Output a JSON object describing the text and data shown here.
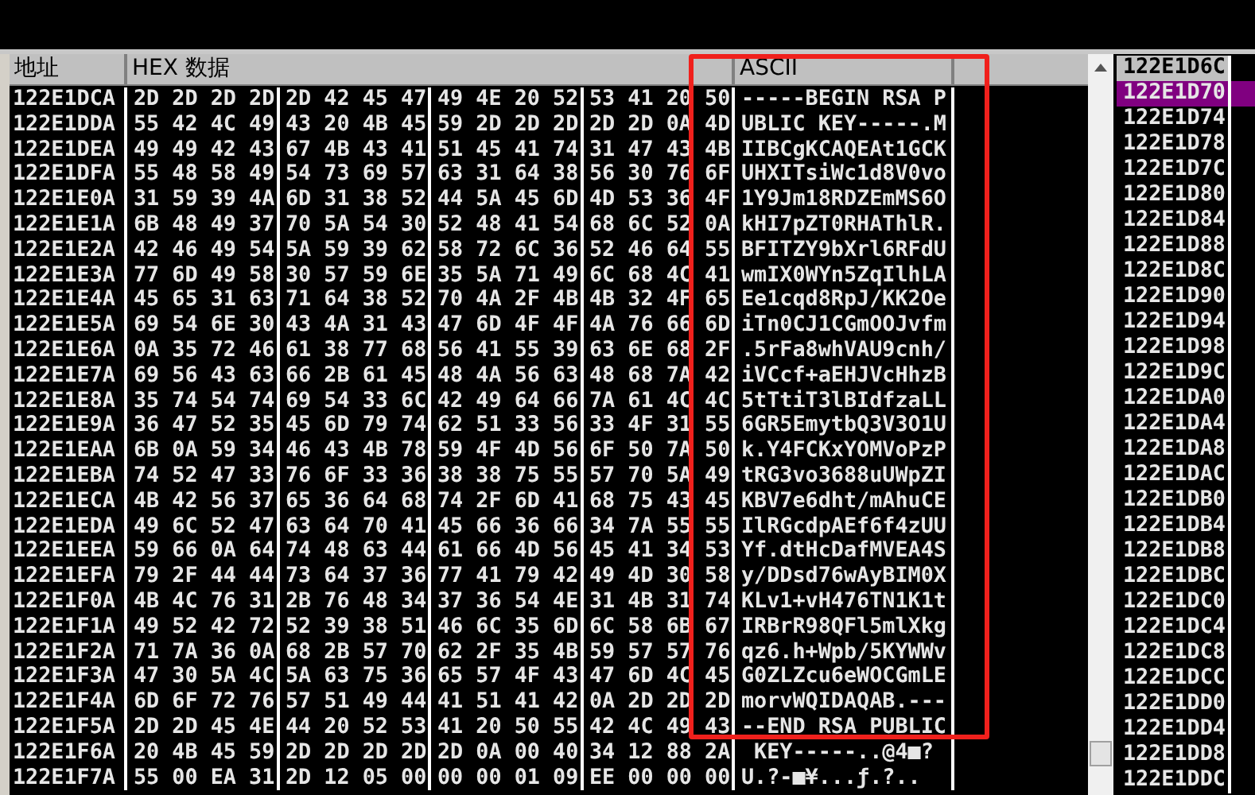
{
  "header": {
    "columns": [
      "地址",
      "HEX 数据",
      "ASCII"
    ]
  },
  "rows": [
    {
      "address": "122E1DCA",
      "hex": [
        "2D 2D 2D 2D",
        "2D 42 45 47",
        "49 4E 20 52",
        "53 41 20 50"
      ],
      "ascii": "-----BEGIN RSA P"
    },
    {
      "address": "122E1DDA",
      "hex": [
        "55 42 4C 49",
        "43 20 4B 45",
        "59 2D 2D 2D",
        "2D 2D 0A 4D"
      ],
      "ascii": "UBLIC KEY-----.M"
    },
    {
      "address": "122E1DEA",
      "hex": [
        "49 49 42 43",
        "67 4B 43 41",
        "51 45 41 74",
        "31 47 43 4B"
      ],
      "ascii": "IIBCgKCAQEAt1GCK"
    },
    {
      "address": "122E1DFA",
      "hex": [
        "55 48 58 49",
        "54 73 69 57",
        "63 31 64 38",
        "56 30 76 6F"
      ],
      "ascii": "UHXITsiWc1d8V0vo"
    },
    {
      "address": "122E1E0A",
      "hex": [
        "31 59 39 4A",
        "6D 31 38 52",
        "44 5A 45 6D",
        "4D 53 36 4F"
      ],
      "ascii": "1Y9Jm18RDZEmMS6O"
    },
    {
      "address": "122E1E1A",
      "hex": [
        "6B 48 49 37",
        "70 5A 54 30",
        "52 48 41 54",
        "68 6C 52 0A"
      ],
      "ascii": "kHI7pZT0RHAThlR."
    },
    {
      "address": "122E1E2A",
      "hex": [
        "42 46 49 54",
        "5A 59 39 62",
        "58 72 6C 36",
        "52 46 64 55"
      ],
      "ascii": "BFITZY9bXrl6RFdU"
    },
    {
      "address": "122E1E3A",
      "hex": [
        "77 6D 49 58",
        "30 57 59 6E",
        "35 5A 71 49",
        "6C 68 4C 41"
      ],
      "ascii": "wmIX0WYn5ZqIlhLA"
    },
    {
      "address": "122E1E4A",
      "hex": [
        "45 65 31 63",
        "71 64 38 52",
        "70 4A 2F 4B",
        "4B 32 4F 65"
      ],
      "ascii": "Ee1cqd8RpJ/KK2Oe"
    },
    {
      "address": "122E1E5A",
      "hex": [
        "69 54 6E 30",
        "43 4A 31 43",
        "47 6D 4F 4F",
        "4A 76 66 6D"
      ],
      "ascii": "iTn0CJ1CGmOOJvfm"
    },
    {
      "address": "122E1E6A",
      "hex": [
        "0A 35 72 46",
        "61 38 77 68",
        "56 41 55 39",
        "63 6E 68 2F"
      ],
      "ascii": ".5rFa8whVAU9cnh/"
    },
    {
      "address": "122E1E7A",
      "hex": [
        "69 56 43 63",
        "66 2B 61 45",
        "48 4A 56 63",
        "48 68 7A 42"
      ],
      "ascii": "iVCcf+aEHJVcHhzB"
    },
    {
      "address": "122E1E8A",
      "hex": [
        "35 74 54 74",
        "69 54 33 6C",
        "42 49 64 66",
        "7A 61 4C 4C"
      ],
      "ascii": "5tTtiT3lBIdfzaLL"
    },
    {
      "address": "122E1E9A",
      "hex": [
        "36 47 52 35",
        "45 6D 79 74",
        "62 51 33 56",
        "33 4F 31 55"
      ],
      "ascii": "6GR5EmytbQ3V3O1U"
    },
    {
      "address": "122E1EAA",
      "hex": [
        "6B 0A 59 34",
        "46 43 4B 78",
        "59 4F 4D 56",
        "6F 50 7A 50"
      ],
      "ascii": "k.Y4FCKxYOMVoPzP"
    },
    {
      "address": "122E1EBA",
      "hex": [
        "74 52 47 33",
        "76 6F 33 36",
        "38 38 75 55",
        "57 70 5A 49"
      ],
      "ascii": "tRG3vo3688uUWpZI"
    },
    {
      "address": "122E1ECA",
      "hex": [
        "4B 42 56 37",
        "65 36 64 68",
        "74 2F 6D 41",
        "68 75 43 45"
      ],
      "ascii": "KBV7e6dht/mAhuCE"
    },
    {
      "address": "122E1EDA",
      "hex": [
        "49 6C 52 47",
        "63 64 70 41",
        "45 66 36 66",
        "34 7A 55 55"
      ],
      "ascii": "IlRGcdpAEf6f4zUU"
    },
    {
      "address": "122E1EEA",
      "hex": [
        "59 66 0A 64",
        "74 48 63 44",
        "61 66 4D 56",
        "45 41 34 53"
      ],
      "ascii": "Yf.dtHcDafMVEA4S"
    },
    {
      "address": "122E1EFA",
      "hex": [
        "79 2F 44 44",
        "73 64 37 36",
        "77 41 79 42",
        "49 4D 30 58"
      ],
      "ascii": "y/DDsd76wAyBIM0X"
    },
    {
      "address": "122E1F0A",
      "hex": [
        "4B 4C 76 31",
        "2B 76 48 34",
        "37 36 54 4E",
        "31 4B 31 74"
      ],
      "ascii": "KLv1+vH476TN1K1t"
    },
    {
      "address": "122E1F1A",
      "hex": [
        "49 52 42 72",
        "52 39 38 51",
        "46 6C 35 6D",
        "6C 58 6B 67"
      ],
      "ascii": "IRBrR98QFl5mlXkg"
    },
    {
      "address": "122E1F2A",
      "hex": [
        "71 7A 36 0A",
        "68 2B 57 70",
        "62 2F 35 4B",
        "59 57 57 76"
      ],
      "ascii": "qz6.h+Wpb/5KYWWv"
    },
    {
      "address": "122E1F3A",
      "hex": [
        "47 30 5A 4C",
        "5A 63 75 36",
        "65 57 4F 43",
        "47 6D 4C 45"
      ],
      "ascii": "G0ZLZcu6eWOCGmLE"
    },
    {
      "address": "122E1F4A",
      "hex": [
        "6D 6F 72 76",
        "57 51 49 44",
        "41 51 41 42",
        "0A 2D 2D 2D"
      ],
      "ascii": "morvWQIDAQAB.---"
    },
    {
      "address": "122E1F5A",
      "hex": [
        "2D 2D 45 4E",
        "44 20 52 53",
        "41 20 50 55",
        "42 4C 49 43"
      ],
      "ascii": "--END RSA PUBLIC"
    },
    {
      "address": "122E1F6A",
      "hex": [
        "20 4B 45 59",
        "2D 2D 2D 2D",
        "2D 0A 00 40",
        "34 12 88 2A"
      ],
      "ascii": " KEY-----..@4■?"
    },
    {
      "address": "122E1F7A",
      "hex": [
        "55 00 EA 31",
        "2D 12 05 00",
        "00 00 01 09",
        "EE 00 00 00"
      ],
      "ascii": "U.?-■¥...ƒ.?.."
    }
  ],
  "stack": {
    "rows": [
      {
        "address": "122E1D6C",
        "marked": true,
        "selected": false
      },
      {
        "address": "122E1D70",
        "marked": false,
        "selected": true
      },
      {
        "address": "122E1D74",
        "marked": false,
        "selected": false
      },
      {
        "address": "122E1D78",
        "marked": false,
        "selected": false
      },
      {
        "address": "122E1D7C",
        "marked": false,
        "selected": false
      },
      {
        "address": "122E1D80",
        "marked": false,
        "selected": false
      },
      {
        "address": "122E1D84",
        "marked": false,
        "selected": false
      },
      {
        "address": "122E1D88",
        "marked": false,
        "selected": false
      },
      {
        "address": "122E1D8C",
        "marked": false,
        "selected": false
      },
      {
        "address": "122E1D90",
        "marked": false,
        "selected": false
      },
      {
        "address": "122E1D94",
        "marked": false,
        "selected": false
      },
      {
        "address": "122E1D98",
        "marked": false,
        "selected": false
      },
      {
        "address": "122E1D9C",
        "marked": false,
        "selected": false
      },
      {
        "address": "122E1DA0",
        "marked": false,
        "selected": false
      },
      {
        "address": "122E1DA4",
        "marked": false,
        "selected": false
      },
      {
        "address": "122E1DA8",
        "marked": false,
        "selected": false
      },
      {
        "address": "122E1DAC",
        "marked": false,
        "selected": false
      },
      {
        "address": "122E1DB0",
        "marked": false,
        "selected": false
      },
      {
        "address": "122E1DB4",
        "marked": false,
        "selected": false
      },
      {
        "address": "122E1DB8",
        "marked": false,
        "selected": false
      },
      {
        "address": "122E1DBC",
        "marked": false,
        "selected": false
      },
      {
        "address": "122E1DC0",
        "marked": false,
        "selected": false
      },
      {
        "address": "122E1DC4",
        "marked": false,
        "selected": false
      },
      {
        "address": "122E1DC8",
        "marked": false,
        "selected": false
      },
      {
        "address": "122E1DCC",
        "marked": false,
        "selected": false
      },
      {
        "address": "122E1DD0",
        "marked": false,
        "selected": false
      },
      {
        "address": "122E1DD4",
        "marked": false,
        "selected": false
      },
      {
        "address": "122E1DD8",
        "marked": false,
        "selected": false
      },
      {
        "address": "122E1DDC",
        "marked": false,
        "selected": false
      }
    ]
  },
  "annotation": {
    "kind": "rectangle"
  }
}
